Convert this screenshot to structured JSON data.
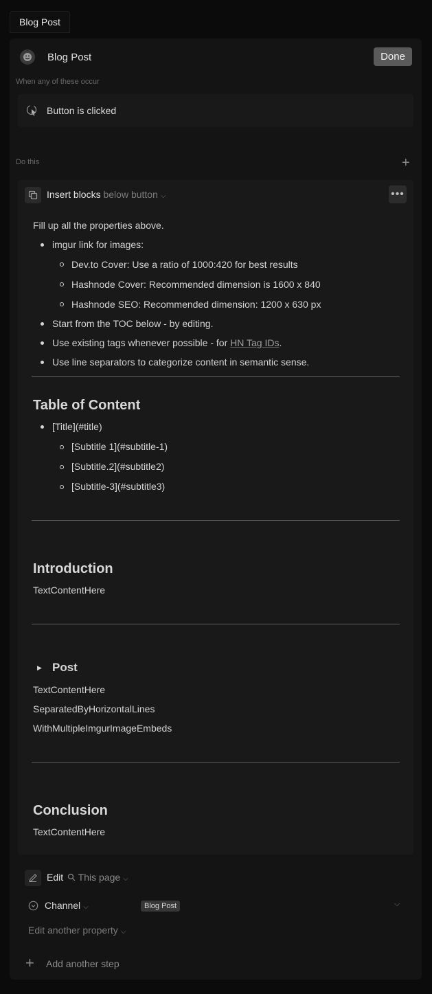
{
  "tab": {
    "label": "Blog Post"
  },
  "header": {
    "title": "Blog Post",
    "done_label": "Done"
  },
  "trigger": {
    "section_label": "When any of these occur",
    "item_label": "Button is clicked"
  },
  "actions": {
    "section_label": "Do this",
    "insert": {
      "label": "Insert blocks",
      "position": "below button"
    }
  },
  "content": {
    "intro_line": "Fill up all the properties above.",
    "bullets": {
      "b1": "imgur link for images:",
      "b1_sub": [
        "Dev.to Cover: Use a ratio of 1000:420 for best results",
        "Hashnode Cover: Recommended dimension is 1600 x 840",
        "Hashnode SEO: Recommended dimension: 1200 x 630 px"
      ],
      "b2": "Start from the TOC below - by editing.",
      "b3_prefix": "Use existing tags whenever possible - for ",
      "b3_link": "HN Tag IDs",
      "b3_suffix": ".",
      "b4": "Use line separators to categorize content in semantic sense."
    },
    "toc": {
      "heading": "Table of Content",
      "item": "[Title](#title)",
      "sub": [
        "[Subtitle 1](#subtitle-1)",
        "[Subtitle.2](#subtitle2)",
        "[Subtitle-3](#subtitle3)"
      ]
    },
    "introduction": {
      "heading": "Introduction",
      "text": "TextContentHere"
    },
    "post": {
      "heading": "Post",
      "lines": [
        "TextContentHere",
        "SeparatedByHorizontalLines",
        "WithMultipleImgurImageEmbeds"
      ]
    },
    "conclusion": {
      "heading": "Conclusion",
      "text": "TextContentHere"
    }
  },
  "edit": {
    "label": "Edit",
    "target": "This page",
    "property": "Channel",
    "value": "Blog Post",
    "another_property": "Edit another property"
  },
  "add_step": "Add another step"
}
